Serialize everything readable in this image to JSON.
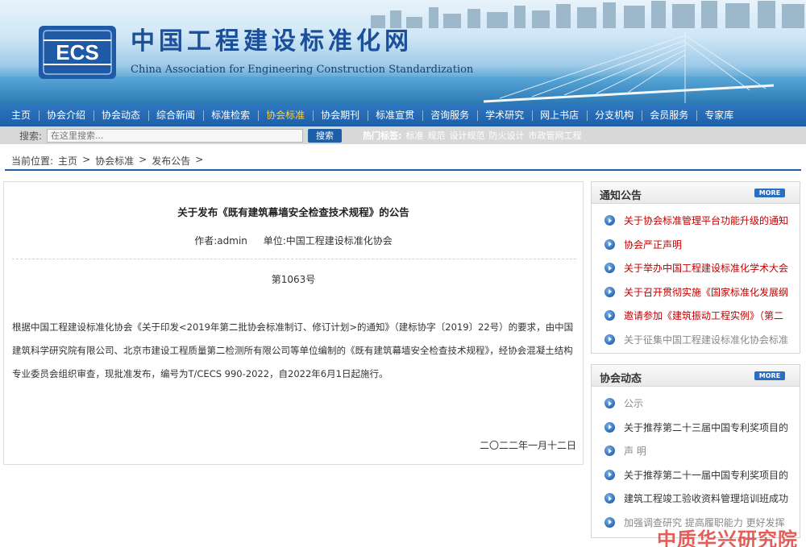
{
  "site": {
    "title": "中国工程建设标准化网",
    "subtitle": "China Association for Engineering Construction Standardization",
    "logo_text": "ECS"
  },
  "nav": [
    "主页",
    "协会介绍",
    "协会动态",
    "综合新闻",
    "标准检索",
    "协会标准",
    "协会期刊",
    "标准宣贯",
    "咨询服务",
    "学术研究",
    "网上书店",
    "分支机构",
    "会员服务",
    "专家库"
  ],
  "nav_active": "协会标准",
  "search": {
    "label": "搜索:",
    "placeholder": "在这里搜索...",
    "button": "搜索",
    "hot_label": "热门标签:",
    "tags": [
      "标准",
      "规范",
      "设计规范",
      "防火设计",
      "市政管网工程"
    ]
  },
  "breadcrumb": {
    "prefix": "当前位置:",
    "items": [
      "主页",
      "协会标准",
      "发布公告"
    ],
    "sep": ">"
  },
  "article": {
    "title": "关于发布《既有建筑幕墙安全检查技术规程》的公告",
    "author": "作者:admin",
    "unit": "单位:中国工程建设标准化协会",
    "number": "第1063号",
    "body": "根据中国工程建设标准化协会《关于印发<2019年第二批协会标准制订、修订计划>的通知》（建标协字〔2019〕22号）的要求，由中国建筑科学研究院有限公司、北京市建设工程质量第二检测所有限公司等单位编制的《既有建筑幕墙安全检查技术规程》，经协会混凝土结构专业委员会组织审查，现批准发布，编号为T/CECS 990-2022，自2022年6月1日起施行。",
    "date": "二〇二二年一月十二日"
  },
  "notices": {
    "title": "通知公告",
    "more": "MORE",
    "items": [
      {
        "text": "关于协会标准管理平台功能升级的通知",
        "style": "red"
      },
      {
        "text": "协会严正声明",
        "style": "red"
      },
      {
        "text": "关于举办中国工程建设标准化学术大会",
        "style": "red"
      },
      {
        "text": "关于召开贯彻实施《国家标准化发展纲",
        "style": "red"
      },
      {
        "text": "邀请参加《建筑振动工程实例》（第二",
        "style": "red"
      },
      {
        "text": "关于征集中国工程建设标准化协会标准",
        "style": "grey"
      }
    ]
  },
  "news": {
    "title": "协会动态",
    "more": "MORE",
    "items": [
      {
        "text": "公示",
        "style": "grey"
      },
      {
        "text": "关于推荐第二十三届中国专利奖项目的",
        "style": "normal"
      },
      {
        "text": "声 明",
        "style": "grey"
      },
      {
        "text": "关于推荐第二十一届中国专利奖项目的",
        "style": "normal"
      },
      {
        "text": "建筑工程竣工验收资料管理培训班成功",
        "style": "normal"
      },
      {
        "text": "加强调查研究 提高履职能力 更好发挥",
        "style": "grey"
      }
    ]
  },
  "watermark": "中质华兴研究院",
  "colors": {
    "nav": "#1d5ea8",
    "active": "#ffd23e",
    "red_link": "#c00000"
  }
}
